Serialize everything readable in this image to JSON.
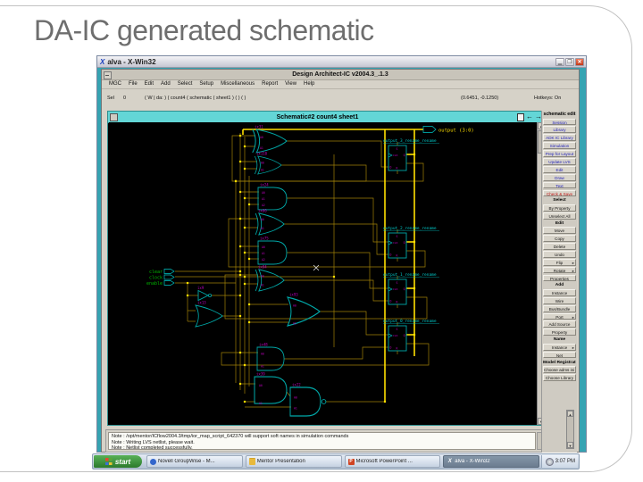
{
  "slide": {
    "title": "DA-IC generated schematic"
  },
  "xwin": {
    "title": "alva - X-Win32"
  },
  "da": {
    "title": "Design Architect-IC v2004.3_.1.3",
    "menus": [
      "MGC",
      "File",
      "Edit",
      "Add",
      "Select",
      "Setup",
      "Miscellaneous",
      "Report",
      "View",
      "Help"
    ],
    "status": {
      "sel_label": "Sel",
      "sel_count": "0",
      "context": "( W | da: ) ( count4 ( schematic ( sheet1 ) ( ) ( )",
      "coords": "(0.6451, -0.1250)",
      "hotkeys": "Hotkeys: On"
    },
    "notes": [
      "Note : /opt/mentor/ICflow2004.3/tmp/ior_map_script_642370 will support soft names in simulation commands",
      "Note : Writing LVS netlist, please wait.",
      "Note : Netlist completed successfully."
    ]
  },
  "schematic_window": {
    "title": "Schematic#2 count4 sheet1",
    "ports": {
      "output_bus": "output (3:0)",
      "clear": "clear",
      "clock": "clock",
      "enable": "enable"
    },
    "nets": {
      "n3": "output_3_rename_rename",
      "n2": "output_2_rename_rename",
      "n1": "output_1_rename_rename",
      "n0": "output_0_rename_rename"
    },
    "instances": {
      "xor1": "ix31",
      "xor2": "ix110",
      "and3a": "ix24",
      "xor3": "ix66",
      "and3b": "ix75",
      "xor4": "ix84",
      "orbig": "ix93",
      "and2a": "ix48",
      "and2b": "ix39",
      "nand": "ix22",
      "buf": "ix9",
      "orsm": "ix13"
    },
    "pins": {
      "a0": "A0",
      "a1": "A1",
      "a2": "A2",
      "d": "D",
      "clk": "CLK",
      "q": "Q",
      "s": "S",
      "r": "R"
    }
  },
  "palette": {
    "header": "schematic edit",
    "items": [
      {
        "label": "Session",
        "type": "link"
      },
      {
        "label": "Library",
        "type": "link"
      },
      {
        "label": "ADK IC Library",
        "type": "link"
      },
      {
        "label": "Simulation",
        "type": "link"
      },
      {
        "label": "Prep for Layout",
        "type": "link"
      },
      {
        "label": "Update LVS",
        "type": "link"
      },
      {
        "label": "Edit",
        "type": "link"
      },
      {
        "label": "Draw",
        "type": "link"
      },
      {
        "label": "Text",
        "type": "link"
      },
      {
        "label": "Check & Save",
        "type": "danger"
      },
      {
        "label": "Select",
        "type": "header"
      },
      {
        "label": "By Property",
        "type": "item"
      },
      {
        "label": "Unselect All",
        "type": "item"
      },
      {
        "label": "Edit",
        "type": "header"
      },
      {
        "label": "Move",
        "type": "item"
      },
      {
        "label": "Copy",
        "type": "item"
      },
      {
        "label": "Delete",
        "type": "item"
      },
      {
        "label": "Undo",
        "type": "item"
      },
      {
        "label": "Flip",
        "type": "item",
        "arrow": true
      },
      {
        "label": "Rotate",
        "type": "item",
        "arrow": true
      },
      {
        "label": "Properties",
        "type": "item"
      },
      {
        "label": "Add",
        "type": "header"
      },
      {
        "label": "Instance",
        "type": "item"
      },
      {
        "label": "Wire",
        "type": "item"
      },
      {
        "label": "Bus/Bundle",
        "type": "item"
      },
      {
        "label": "Port",
        "type": "item",
        "arrow": true
      },
      {
        "label": "Add Source",
        "type": "item"
      },
      {
        "label": "Property",
        "type": "item"
      },
      {
        "label": "Name",
        "type": "header"
      },
      {
        "label": "Instance",
        "type": "item",
        "arrow": true
      },
      {
        "label": "Net",
        "type": "item"
      },
      {
        "label": "Model Registration",
        "type": "header"
      },
      {
        "label": "Choose adms ini File",
        "type": "item"
      },
      {
        "label": "Choose Library",
        "type": "item"
      }
    ]
  },
  "taskbar": {
    "start_label": "start",
    "tasks": [
      {
        "label": "Novell GroupWise - M...",
        "icon": "groupwise",
        "active": false
      },
      {
        "label": "Mentor Presentation",
        "icon": "folder",
        "active": false
      },
      {
        "label": "Microsoft PowerPoint ...",
        "icon": "powerpoint",
        "active": false
      },
      {
        "label": "alva - X-Win32",
        "icon": "xwin",
        "active": true
      }
    ],
    "clock": "3:07 PM"
  },
  "colors": {
    "schematic_titlebar": "#63d6d6",
    "wire": "#a08008",
    "bus": "#ffdf00",
    "gate": "#00a8a8",
    "net_label": "#00c8c8",
    "instance_label": "#c000c0",
    "input_label": "#00b400",
    "x_root_backdrop": "#35a3b2"
  }
}
